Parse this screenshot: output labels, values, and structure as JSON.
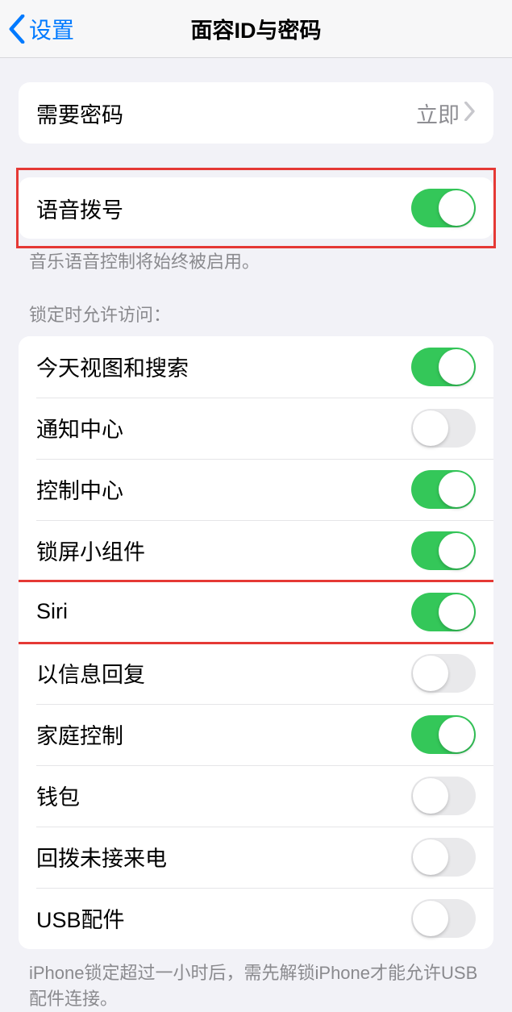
{
  "nav": {
    "back_label": "设置",
    "title": "面容ID与密码"
  },
  "passcode": {
    "label": "需要密码",
    "value": "立即"
  },
  "voice_dial": {
    "label": "语音拨号",
    "enabled": true,
    "footer": "音乐语音控制将始终被启用。"
  },
  "locked_access": {
    "header": "锁定时允许访问：",
    "items": [
      {
        "label": "今天视图和搜索",
        "enabled": true,
        "highlighted": false
      },
      {
        "label": "通知中心",
        "enabled": false,
        "highlighted": false
      },
      {
        "label": "控制中心",
        "enabled": true,
        "highlighted": false
      },
      {
        "label": "锁屏小组件",
        "enabled": true,
        "highlighted": false
      },
      {
        "label": "Siri",
        "enabled": true,
        "highlighted": true
      },
      {
        "label": "以信息回复",
        "enabled": false,
        "highlighted": false
      },
      {
        "label": "家庭控制",
        "enabled": true,
        "highlighted": false
      },
      {
        "label": "钱包",
        "enabled": false,
        "highlighted": false
      },
      {
        "label": "回拨未接来电",
        "enabled": false,
        "highlighted": false
      },
      {
        "label": "USB配件",
        "enabled": false,
        "highlighted": false
      }
    ],
    "footer": "iPhone锁定超过一小时后，需先解锁iPhone才能允许USB配件连接。"
  }
}
